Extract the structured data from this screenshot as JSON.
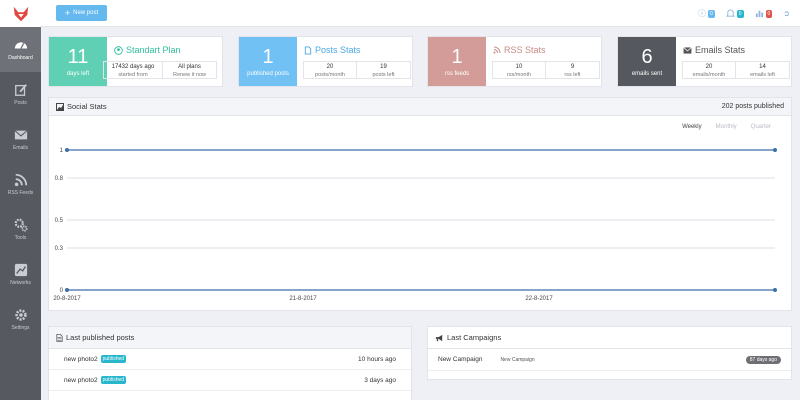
{
  "sidebar": {
    "items": [
      {
        "label": "Dashboard",
        "icon": "dashboard-icon",
        "active": true
      },
      {
        "label": "Posts",
        "icon": "edit-icon"
      },
      {
        "label": "Emails",
        "icon": "envelope-icon"
      },
      {
        "label": "RSS Feeds",
        "icon": "rss-icon"
      },
      {
        "label": "Tools",
        "icon": "cogs-icon"
      },
      {
        "label": "Networks",
        "icon": "networks-icon"
      },
      {
        "label": "Settings",
        "icon": "gear-icon"
      }
    ]
  },
  "topbar": {
    "new_post": "New post",
    "badges": {
      "help": "0",
      "notifications": "0",
      "stats": "0"
    }
  },
  "cards": {
    "plan": {
      "number": "11",
      "label": "days left",
      "title": "Standart Plan",
      "sub": [
        {
          "value": "17432 days ago",
          "caption": "started from"
        },
        {
          "value": "All plans",
          "caption": "Renew it now"
        }
      ],
      "color": "#5fd0b4"
    },
    "posts": {
      "number": "1",
      "label": "published posts",
      "title": "Posts Stats",
      "sub": [
        {
          "value": "20",
          "caption": "posts/month"
        },
        {
          "value": "19",
          "caption": "posts left"
        }
      ],
      "color": "#72c1f4"
    },
    "rss": {
      "number": "1",
      "label": "rss feeds",
      "title": "RSS Stats",
      "sub": [
        {
          "value": "10",
          "caption": "rss/month"
        },
        {
          "value": "9",
          "caption": "rss left"
        }
      ],
      "color": "#d49c98"
    },
    "emails": {
      "number": "6",
      "label": "emails sent",
      "title": "Emails Stats",
      "sub": [
        {
          "value": "20",
          "caption": "emails/month"
        },
        {
          "value": "14",
          "caption": "emails left"
        }
      ],
      "color": "#55585e"
    }
  },
  "social": {
    "title": "Social Stats",
    "published": "202 posts published",
    "tabs": [
      "Weekly",
      "Monthly",
      "Quarter"
    ]
  },
  "chart_data": {
    "type": "line",
    "x": [
      "20-8-2017",
      "21-8-2017",
      "22-8-2017"
    ],
    "yticks": [
      "0",
      "0.3",
      "0.5",
      "0.8",
      "1"
    ],
    "ylim": [
      0,
      1
    ],
    "series": [
      {
        "values": [
          1,
          1
        ],
        "color": "#3a6fa8"
      },
      {
        "values": [
          0,
          0
        ],
        "color": "#3a6fa8"
      }
    ]
  },
  "last_posts": {
    "title": "Last published posts",
    "rows": [
      {
        "name": "new photo2",
        "badge": "published",
        "time": "10 hours ago"
      },
      {
        "name": "new photo2",
        "badge": "published",
        "time": "3 days ago"
      }
    ]
  },
  "campaigns": {
    "title": "Last Campaigns",
    "rows": [
      {
        "name": "New Campaign",
        "desc": "New Campaign",
        "time": "87 days ago"
      }
    ]
  }
}
